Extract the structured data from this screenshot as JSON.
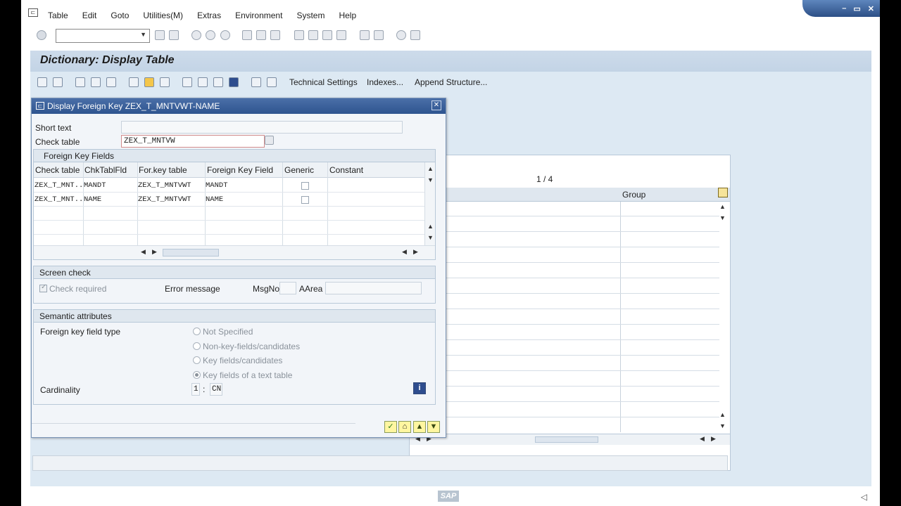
{
  "menu": {
    "items": [
      "Table",
      "Edit",
      "Goto",
      "Utilities(M)",
      "Extras",
      "Environment",
      "System",
      "Help"
    ]
  },
  "window": {
    "minimize": "–",
    "restore": "▭",
    "close": "✕"
  },
  "page": {
    "title": "Dictionary: Display Table"
  },
  "app_toolbar": {
    "technical_settings": "Technical Settings",
    "indexes": "Indexes...",
    "append_structure": "Append Structure..."
  },
  "background": {
    "pages": "1 / 4",
    "group_header": "Group"
  },
  "dialog": {
    "title": "Display Foreign Key ZEX_T_MNTVWT-NAME",
    "short_text_label": "Short text",
    "short_text_value": "",
    "check_table_label": "Check table",
    "check_table_value": "ZEX_T_MNTVW",
    "fk_fields": {
      "title": "Foreign Key Fields",
      "columns": [
        "Check table",
        "ChkTablFld",
        "For.key table",
        "Foreign Key Field",
        "Generic",
        "Constant"
      ],
      "rows": [
        {
          "check_table": "ZEX_T_MNT..",
          "chk_field": "MANDT",
          "for_key_table": "ZEX_T_MNTVWT",
          "fk_field": "MANDT",
          "generic": false,
          "constant": ""
        },
        {
          "check_table": "ZEX_T_MNT..",
          "chk_field": "NAME",
          "for_key_table": "ZEX_T_MNTVWT",
          "fk_field": "NAME",
          "generic": false,
          "constant": ""
        }
      ]
    },
    "screen_check": {
      "title": "Screen check",
      "check_required": "Check required",
      "check_required_checked": true,
      "error_message": "Error message",
      "msgno_label": "MsgNo",
      "msgno_value": "",
      "aarea_label": "AArea",
      "aarea_value": ""
    },
    "semantic": {
      "title": "Semantic attributes",
      "fk_field_type": "Foreign key field type",
      "options": [
        "Not Specified",
        "Non-key-fields/candidates",
        "Key fields/candidates",
        "Key fields of a text table"
      ],
      "selected_index": 3,
      "cardinality_label": "Cardinality",
      "card_left": "1",
      "card_sep": ":",
      "card_right": "CN"
    }
  },
  "status": {
    "logo": "SAP"
  }
}
